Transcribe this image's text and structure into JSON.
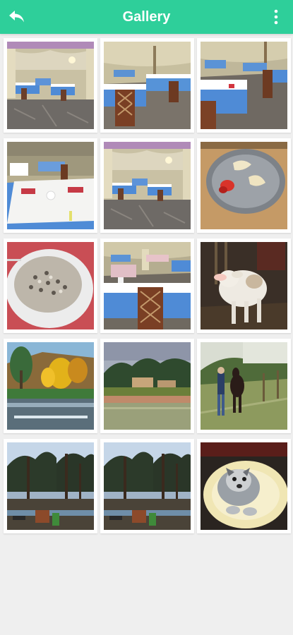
{
  "header": {
    "title": "Gallery",
    "back_icon": "back-arrow-icon",
    "menu_icon": "more-vert-icon",
    "bg_color": "#2ecf9a"
  },
  "gallery": {
    "photos": [
      {
        "subject": "restaurant-tent-interior"
      },
      {
        "subject": "restaurant-tables-chairs"
      },
      {
        "subject": "restaurant-tables-chairs"
      },
      {
        "subject": "restaurant-table-setting"
      },
      {
        "subject": "restaurant-tent-interior"
      },
      {
        "subject": "pasta-plate"
      },
      {
        "subject": "risotto-plate"
      },
      {
        "subject": "restaurant-tables-chairs"
      },
      {
        "subject": "calf-in-barn"
      },
      {
        "subject": "autumn-trees-pond"
      },
      {
        "subject": "lake-with-building"
      },
      {
        "subject": "person-with-horse"
      },
      {
        "subject": "pine-trees-lake"
      },
      {
        "subject": "pine-trees-lake"
      },
      {
        "subject": "puppy-in-basket"
      }
    ]
  }
}
